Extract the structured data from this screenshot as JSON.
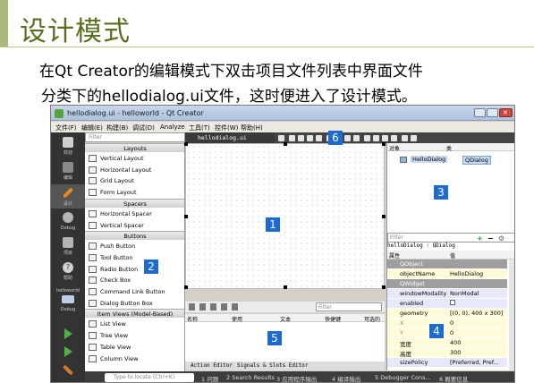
{
  "slide": {
    "title": "设计模式",
    "line1": "在Qt Creator的编辑模式下双击项目文件列表中界面文件",
    "line2": "分类下的hellodialog.ui文件，这时便进入了设计模式。"
  },
  "window": {
    "title": "hellodialog.ui - helloworld - Qt Creator",
    "menu": [
      "文件(F)",
      "编辑(E)",
      "构建(B)",
      "调试(D)",
      "Analyze",
      "工具(T)",
      "控件(W)",
      "帮助(H)"
    ],
    "modes": [
      {
        "label": "欢迎",
        "icon": "grid-icon",
        "color": "#cfcfcf"
      },
      {
        "label": "编辑",
        "icon": "edit-icon",
        "color": "#8a8a8a"
      },
      {
        "label": "设计",
        "icon": "pen-icon",
        "color": "#e58d1a"
      },
      {
        "label": "Debug",
        "icon": "bug-icon",
        "color": "#b5b5b5"
      },
      {
        "label": "项目",
        "icon": "wrench-icon",
        "color": "#b5b5b5"
      },
      {
        "label": "帮助",
        "icon": "help-icon",
        "color": "#d0d0d0"
      }
    ],
    "kit": "helloworld",
    "kit_mode": "Debug",
    "file_tab": "hellodialog.ui",
    "widget_filter_placeholder": "Filter",
    "widget_box": [
      {
        "type": "cat",
        "label": "Layouts"
      },
      {
        "type": "item",
        "label": "Vertical Layout"
      },
      {
        "type": "item",
        "label": "Horizontal Layout"
      },
      {
        "type": "item",
        "label": "Grid Layout"
      },
      {
        "type": "item",
        "label": "Form Layout"
      },
      {
        "type": "cat",
        "label": "Spacers"
      },
      {
        "type": "item",
        "label": "Horizontal Spacer"
      },
      {
        "type": "item",
        "label": "Vertical Spacer"
      },
      {
        "type": "cat",
        "label": "Buttons"
      },
      {
        "type": "item",
        "label": "Push Button"
      },
      {
        "type": "item",
        "label": "Tool Button"
      },
      {
        "type": "item",
        "label": "Radio Button"
      },
      {
        "type": "item",
        "label": "Check Box"
      },
      {
        "type": "item",
        "label": "Command Link Button"
      },
      {
        "type": "item",
        "label": "Dialog Button Box"
      },
      {
        "type": "cat",
        "label": "Item Views (Model-Based)"
      },
      {
        "type": "item",
        "label": "List View"
      },
      {
        "type": "item",
        "label": "Tree View"
      },
      {
        "type": "item",
        "label": "Table View"
      },
      {
        "type": "item",
        "label": "Column View"
      }
    ],
    "action_filter_placeholder": "Filter",
    "action_columns": [
      "名称",
      "使用",
      "文本",
      "快捷键",
      "可选的"
    ],
    "bottom_tabs": [
      "Action Editor",
      "Signals & Slots Editor"
    ],
    "object_columns": [
      "对象",
      "类"
    ],
    "object_row": {
      "name": "HelloDialog",
      "class": "QDialog"
    },
    "prop_filter_placeholder": "Filter",
    "prop_subtitle": "helloDialog : QDialog",
    "prop_columns": [
      "属性",
      "值"
    ],
    "properties": [
      {
        "k": "QObject",
        "v": "",
        "style": "group"
      },
      {
        "k": "objectName",
        "v": "HelloDialog",
        "style": "yellow"
      },
      {
        "k": "QWidget",
        "v": "",
        "style": "group"
      },
      {
        "k": "windowModality",
        "v": "NonModal",
        "style": "lav"
      },
      {
        "k": "enabled",
        "v": "check",
        "style": "lav"
      },
      {
        "k": "geometry",
        "v": "[(0, 0), 400 x 300]",
        "style": "yellow"
      },
      {
        "k": "X",
        "v": "0",
        "style": "yellow dim"
      },
      {
        "k": "Y",
        "v": "0",
        "style": "yellow dim"
      },
      {
        "k": "宽度",
        "v": "400",
        "style": "yellow"
      },
      {
        "k": "高度",
        "v": "300",
        "style": "yellow"
      },
      {
        "k": "sizePolicy",
        "v": "[Preferred, Pref...",
        "style": "lav"
      }
    ],
    "status": {
      "locate_placeholder": "Type to locate (Ctrl+K)",
      "items": [
        "1 问题",
        "2 Search Results",
        "3 应用程序输出",
        "4 编译输出",
        "5 Debugger Cons...",
        "6 概要信息"
      ]
    }
  },
  "callouts": [
    "1",
    "2",
    "3",
    "4",
    "5",
    "6"
  ]
}
